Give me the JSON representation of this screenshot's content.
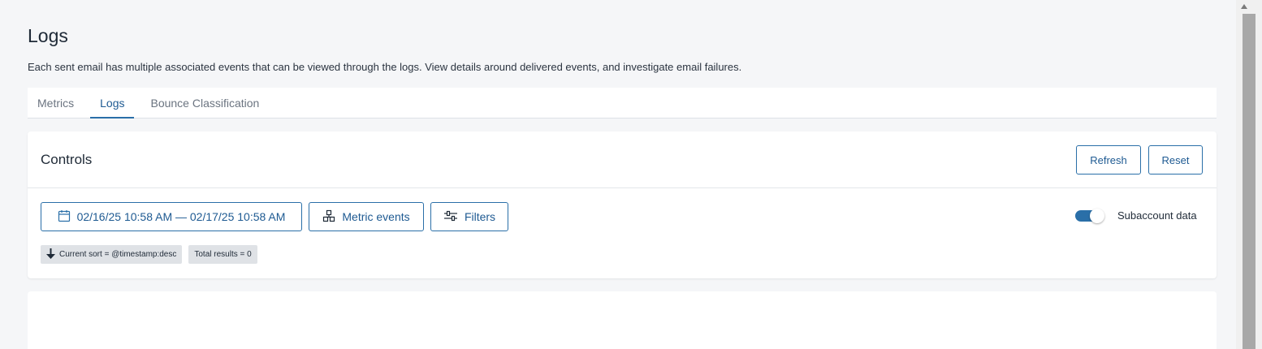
{
  "page": {
    "title": "Logs",
    "description": "Each sent email has multiple associated events that can be viewed through the logs. View details around delivered events, and investigate email failures."
  },
  "tabs": [
    {
      "label": "Metrics",
      "active": false
    },
    {
      "label": "Logs",
      "active": true
    },
    {
      "label": "Bounce Classification",
      "active": false
    }
  ],
  "controls": {
    "title": "Controls",
    "refresh_label": "Refresh",
    "reset_label": "Reset",
    "date_range": "02/16/25 10:58 AM — 02/17/25 10:58 AM",
    "metric_events_label": "Metric events",
    "filters_label": "Filters",
    "subaccount_label": "Subaccount data",
    "subaccount_enabled": true,
    "chips": {
      "sort": "Current sort = @timestamp:desc",
      "total": "Total results = 0"
    }
  },
  "icons": {
    "date": "calendar-icon",
    "metric": "metric-events-icon",
    "filters": "sliders-icon",
    "sort": "arrow-down-icon"
  },
  "colors": {
    "accent": "#2a6fa8",
    "background": "#f5f6f8",
    "card": "#ffffff",
    "chip": "#dfe2e6"
  }
}
